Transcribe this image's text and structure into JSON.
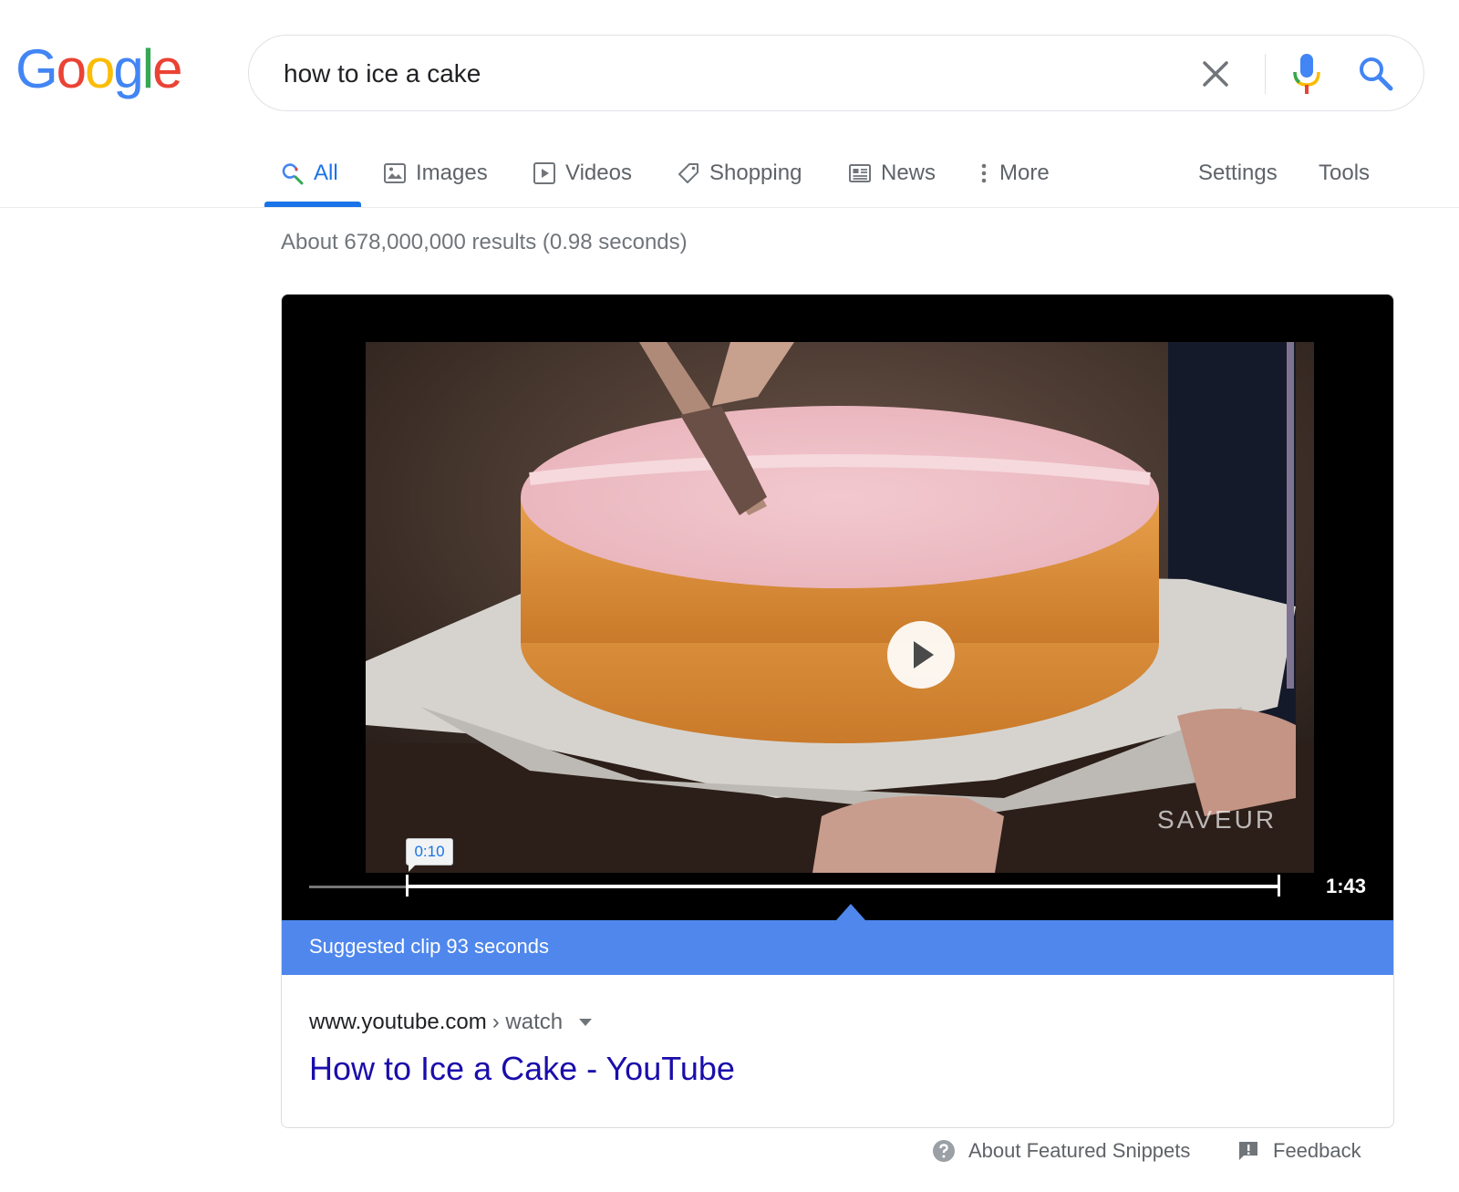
{
  "logo": {
    "letters": [
      "G",
      "o",
      "o",
      "g",
      "l",
      "e"
    ],
    "colors": [
      "#4285F4",
      "#EA4335",
      "#FBBC05",
      "#4285F4",
      "#34A853",
      "#EA4335"
    ]
  },
  "search": {
    "query": "how to ice a cake",
    "icons": [
      "close-icon",
      "microphone-icon",
      "search-icon"
    ]
  },
  "tabs": [
    {
      "label": "All",
      "icon": "search-icon",
      "active": true
    },
    {
      "label": "Images",
      "icon": "image-icon"
    },
    {
      "label": "Videos",
      "icon": "play-box-icon"
    },
    {
      "label": "Shopping",
      "icon": "tag-icon"
    },
    {
      "label": "News",
      "icon": "newspaper-icon"
    },
    {
      "label": "More",
      "icon": "more-vert-icon"
    }
  ],
  "tools": {
    "settings": "Settings",
    "tools": "Tools"
  },
  "stats": "About 678,000,000 results (0.98 seconds)",
  "snippet": {
    "video": {
      "watermark": "SAVEUR",
      "clip_start": "0:10",
      "duration": "1:43"
    },
    "clip_label": "Suggested clip 93 seconds",
    "result": {
      "domain": "www.youtube.com",
      "path": "› watch",
      "title": "How to Ice a Cake - YouTube"
    }
  },
  "footer": {
    "about": "About Featured Snippets",
    "feedback": "Feedback"
  },
  "colors": {
    "accent": "#1a73e8",
    "link": "#1a0dab",
    "clipbar": "#4f87ec"
  }
}
